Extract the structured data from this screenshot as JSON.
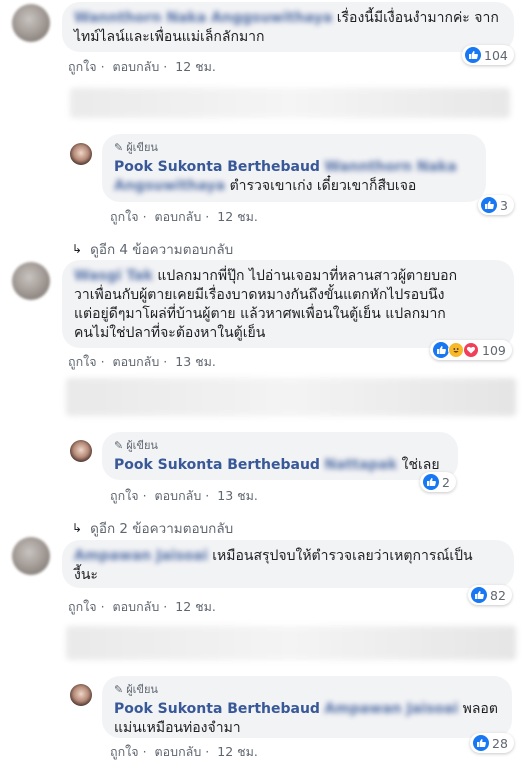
{
  "comments": [
    {
      "name": "Wannthorn Naka Anggsuwithaya",
      "text_lines": [
        "เรื่องนี้มีเงื่อนงำมากค่ะ จาก",
        "ไทม์ไลน์และเพื่อนแม่เล็กลักมาก"
      ],
      "like": "ถูกใจ",
      "reply": "ตอบกลับ",
      "time": "12 ชม.",
      "reaction_count": "104"
    },
    {
      "author_badge": "ผู้เขียน",
      "name": "Pook Sukonta Berthebaud",
      "tag_name": "Wannthorn Naka Angsuwithaya",
      "text": "ตำรวจเขาเก่ง เดี๋ยวเขาก็สืบเจอ",
      "like": "ถูกใจ",
      "reply": "ตอบกลับ",
      "time": "12 ชม.",
      "reaction_count": "3"
    },
    {
      "more_replies": "ดูอีก 4 ข้อความตอบกลับ"
    },
    {
      "name": "Wasgi Tak",
      "text_lines": [
        "แปลกมากพี่ปุ๊ก ไปอ่านเจอมาที่หลานสาวผู้ตายบอก",
        "วาเพื่อนกับผู้ตายเคยมีเรื่องบาดหมางกันถึงขั้นแตกหักไปรอบนึง",
        "แต่อยู่ดีๆมาโผล่ที่บ้านผู้ตาย แล้วหาศพเพื่อนในตู้เย็น แปลกมาก",
        "คนไม่ใช่ปลาที่จะต้องหาในตู้เย็น"
      ],
      "like": "ถูกใจ",
      "reply": "ตอบกลับ",
      "time": "13 ชม.",
      "reaction_count": "109"
    },
    {
      "author_badge": "ผู้เขียน",
      "name": "Pook Sukonta Berthebaud",
      "tag_name": "Nattapak",
      "text": "ใช่เลย",
      "like": "ถูกใจ",
      "reply": "ตอบกลับ",
      "time": "13 ชม.",
      "reaction_count": "2"
    },
    {
      "more_replies": "ดูอีก 2 ข้อความตอบกลับ"
    },
    {
      "name": "Ampawan Jaisoai",
      "text_lines": [
        "เหมือนสรุปจบให้ตำรวจเลยว่าเหตุการณ์เป็น",
        "งี้นะ"
      ],
      "like": "ถูกใจ",
      "reply": "ตอบกลับ",
      "time": "12 ชม.",
      "reaction_count": "82"
    },
    {
      "author_badge": "ผู้เขียน",
      "name": "Pook Sukonta Berthebaud",
      "tag_name": "Ampawan Jaisoai",
      "text_lines": [
        "พลอต",
        "แม่นเหมือนท่องจำมา"
      ],
      "like": "ถูกใจ",
      "reply": "ตอบกลับ",
      "time": "12 ชม.",
      "reaction_count": "28"
    }
  ],
  "colors": {
    "link": "#385898",
    "bubble": "#f2f3f5",
    "meta": "#606770",
    "like_blue": "#1877f2",
    "haha_yellow": "#f7b928",
    "love_red": "#f33e58"
  }
}
